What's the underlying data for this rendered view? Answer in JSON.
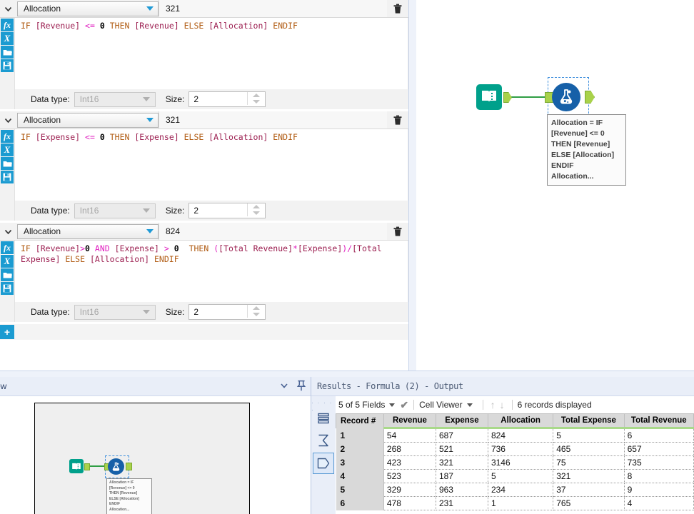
{
  "config_panel": {
    "formulas": [
      {
        "field_label": "Allocation",
        "value": "321",
        "expression_tokens": [
          {
            "t": "IF",
            "c": "kw"
          },
          {
            "t": " ",
            "c": "plain"
          },
          {
            "t": "[Revenue]",
            "c": "fld"
          },
          {
            "t": " ",
            "c": "plain"
          },
          {
            "t": "<=",
            "c": "op"
          },
          {
            "t": " ",
            "c": "plain"
          },
          {
            "t": "0",
            "c": "num"
          },
          {
            "t": " ",
            "c": "plain"
          },
          {
            "t": "THEN",
            "c": "kw"
          },
          {
            "t": " ",
            "c": "plain"
          },
          {
            "t": "[Revenue]",
            "c": "fld"
          },
          {
            "t": " ",
            "c": "plain"
          },
          {
            "t": "ELSE",
            "c": "kw"
          },
          {
            "t": " ",
            "c": "plain"
          },
          {
            "t": "[Allocation]",
            "c": "fld"
          },
          {
            "t": " ",
            "c": "plain"
          },
          {
            "t": "ENDIF",
            "c": "kw"
          }
        ],
        "expression_text": "IF [Revenue] <= 0 THEN [Revenue] ELSE [Allocation] ENDIF",
        "data_type_label": "Data type:",
        "data_type_value": "Int16",
        "size_label": "Size:",
        "size_value": "2"
      },
      {
        "field_label": "Allocation",
        "value": "321",
        "expression_tokens": [
          {
            "t": "IF",
            "c": "kw"
          },
          {
            "t": " ",
            "c": "plain"
          },
          {
            "t": "[Expense]",
            "c": "fld"
          },
          {
            "t": " ",
            "c": "plain"
          },
          {
            "t": "<=",
            "c": "op"
          },
          {
            "t": " ",
            "c": "plain"
          },
          {
            "t": "0",
            "c": "num"
          },
          {
            "t": " ",
            "c": "plain"
          },
          {
            "t": "THEN",
            "c": "kw"
          },
          {
            "t": " ",
            "c": "plain"
          },
          {
            "t": "[Expense]",
            "c": "fld"
          },
          {
            "t": " ",
            "c": "plain"
          },
          {
            "t": "ELSE",
            "c": "kw"
          },
          {
            "t": " ",
            "c": "plain"
          },
          {
            "t": "[Allocation]",
            "c": "fld"
          },
          {
            "t": " ",
            "c": "plain"
          },
          {
            "t": "ENDIF",
            "c": "kw"
          }
        ],
        "expression_text": "IF [Expense] <= 0 THEN [Expense] ELSE [Allocation] ENDIF",
        "data_type_label": "Data type:",
        "data_type_value": "Int16",
        "size_label": "Size:",
        "size_value": "2"
      },
      {
        "field_label": "Allocation",
        "value": "824",
        "expression_tokens": [
          {
            "t": "IF",
            "c": "kw"
          },
          {
            "t": " ",
            "c": "plain"
          },
          {
            "t": "[Revenue]",
            "c": "fld"
          },
          {
            "t": ">",
            "c": "op"
          },
          {
            "t": "0",
            "c": "num"
          },
          {
            "t": " ",
            "c": "plain"
          },
          {
            "t": "AND",
            "c": "op"
          },
          {
            "t": " ",
            "c": "plain"
          },
          {
            "t": "[Expense]",
            "c": "fld"
          },
          {
            "t": " ",
            "c": "plain"
          },
          {
            "t": ">",
            "c": "op"
          },
          {
            "t": " ",
            "c": "plain"
          },
          {
            "t": "0",
            "c": "num"
          },
          {
            "t": "  ",
            "c": "plain"
          },
          {
            "t": "THEN",
            "c": "kw"
          },
          {
            "t": " ",
            "c": "plain"
          },
          {
            "t": "(",
            "c": "op"
          },
          {
            "t": "[Total Revenue]",
            "c": "fld"
          },
          {
            "t": "*",
            "c": "op"
          },
          {
            "t": "[Expense]",
            "c": "fld"
          },
          {
            "t": ")",
            "c": "op"
          },
          {
            "t": "/",
            "c": "op"
          },
          {
            "t": "[Total Expense]",
            "c": "fld"
          },
          {
            "t": " ",
            "c": "plain"
          },
          {
            "t": "ELSE",
            "c": "kw"
          },
          {
            "t": " ",
            "c": "plain"
          },
          {
            "t": "[Allocation]",
            "c": "fld"
          },
          {
            "t": " ",
            "c": "plain"
          },
          {
            "t": "ENDIF",
            "c": "kw"
          }
        ],
        "expression_text": "IF [Revenue]>0 AND [Expense] > 0  THEN ([Total Revenue]*[Expense])/[Total Expense] ELSE [Allocation] ENDIF",
        "data_type_label": "Data type:",
        "data_type_value": "Int16",
        "size_label": "Size:",
        "size_value": "2"
      }
    ],
    "editor_icons": [
      "fx-icon",
      "variable-x-icon",
      "open-folder-icon",
      "save-disk-icon"
    ],
    "add_button_label": "+"
  },
  "canvas": {
    "nodes": [
      {
        "name": "text-input-tool",
        "icon": "book-icon"
      },
      {
        "name": "formula-tool",
        "icon": "flask-icon",
        "selected": true
      }
    ],
    "annotation_lines": [
      "Allocation = IF",
      "[Revenue] <= 0",
      "THEN [Revenue]",
      "ELSE [Allocation]",
      "ENDIF",
      "Allocation..."
    ]
  },
  "overview_panel": {
    "title": "ew",
    "annotation_lines": [
      "Allocation = IF",
      "[Revenue] <= 0",
      "THEN [Revenue]",
      "ELSE [Allocation]",
      "ENDIF",
      "Allocation..."
    ]
  },
  "results_panel": {
    "title": "Results - Formula (2) - Output",
    "toolbar": {
      "fields_label": "5 of 5 Fields",
      "viewer_label": "Cell Viewer",
      "records_label": "6 records displayed"
    },
    "rail_icons": [
      "records-list-icon",
      "summary-sigma-icon",
      "output-anchor-icon"
    ],
    "table": {
      "record_header": "Record #",
      "columns": [
        "Revenue",
        "Expense",
        "Allocation",
        "Total Expense",
        "Total Revenue"
      ],
      "rows": [
        {
          "record": "1",
          "cells": [
            "54",
            "687",
            "824",
            "5",
            "6"
          ]
        },
        {
          "record": "2",
          "cells": [
            "268",
            "521",
            "736",
            "465",
            "657"
          ]
        },
        {
          "record": "3",
          "cells": [
            "423",
            "321",
            "3146",
            "75",
            "735"
          ]
        },
        {
          "record": "4",
          "cells": [
            "523",
            "187",
            "5",
            "321",
            "8"
          ]
        },
        {
          "record": "5",
          "cells": [
            "329",
            "963",
            "234",
            "37",
            "9"
          ]
        },
        {
          "record": "6",
          "cells": [
            "478",
            "231",
            "1",
            "765",
            "4"
          ]
        }
      ]
    }
  },
  "colors": {
    "accent_blue": "#1b9bd1",
    "keyword": "#b05b12",
    "field": "#9b1d4f",
    "operator": "#e020c0",
    "text_input_tool": "#00a08b",
    "formula_tool": "#1660a8",
    "connector_green": "#2f9e44",
    "header_green_underline": "#a9d98a",
    "panel_title_bg": "#e9eef8"
  }
}
